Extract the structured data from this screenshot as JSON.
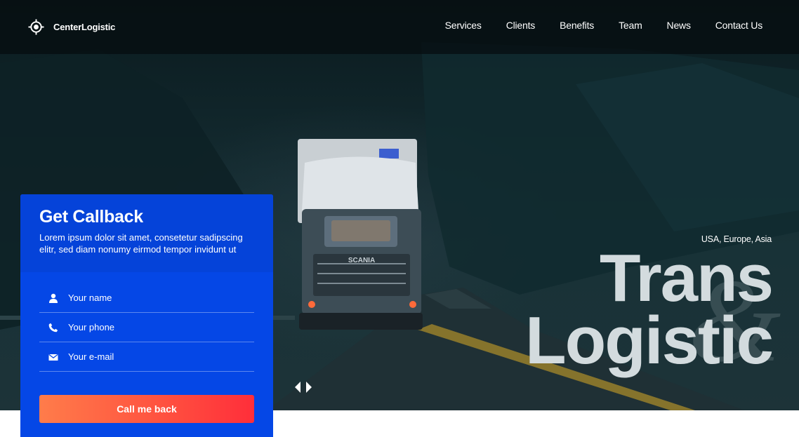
{
  "brand": {
    "name": "CenterLogistic",
    "icon": "target-icon"
  },
  "nav": {
    "items": [
      {
        "label": "Services"
      },
      {
        "label": "Clients"
      },
      {
        "label": "Benefits"
      },
      {
        "label": "Team"
      },
      {
        "label": "News"
      },
      {
        "label": "Contact Us"
      }
    ]
  },
  "hero": {
    "regions": "USA, Europe, Asia",
    "headline_line1": "Trans",
    "headline_line2": "Logistic",
    "ampersand": "&",
    "truck_label": "SCANIA"
  },
  "callback": {
    "title": "Get Callback",
    "description": "Lorem ipsum dolor sit amet, consetetur sadipscing elitr, sed diam nonumy eirmod tempor invidunt ut",
    "fields": [
      {
        "placeholder": "Your name",
        "value": "",
        "icon": "user-icon"
      },
      {
        "placeholder": "Your phone",
        "value": "",
        "icon": "phone-icon"
      },
      {
        "placeholder": "Your e-mail",
        "value": "",
        "icon": "envelope-icon"
      }
    ],
    "button_label": "Call me back"
  },
  "colors": {
    "panel": "#0547e6",
    "panel_head": "#0543d9",
    "button_gradient_start": "#ff7c4a",
    "button_gradient_end": "#ff2e3a",
    "headline": "#d3dbde"
  }
}
